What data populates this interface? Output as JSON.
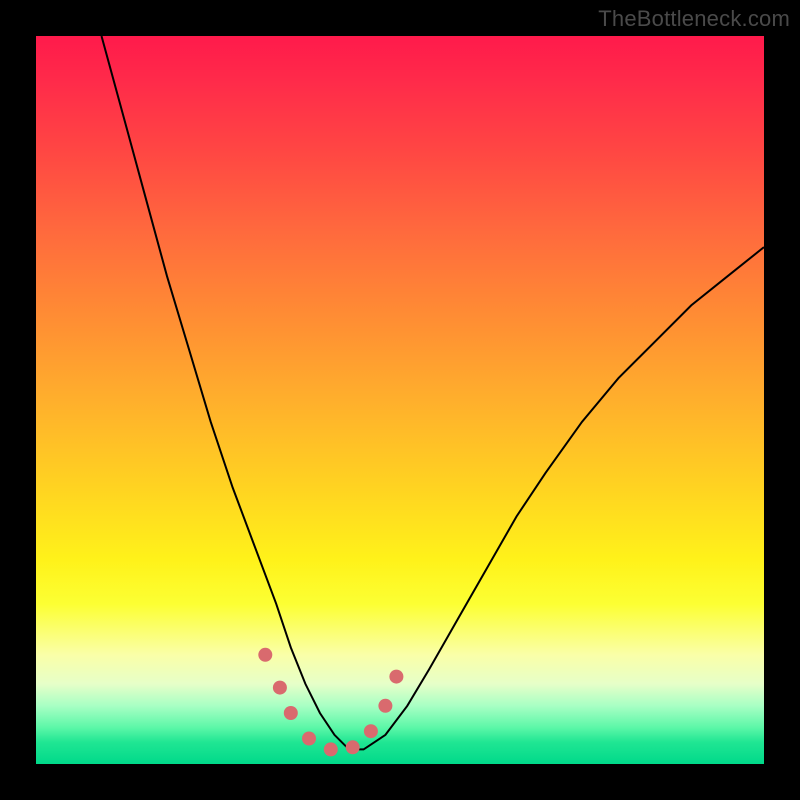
{
  "watermark": "TheBottleneck.com",
  "colors": {
    "frame": "#000000",
    "line": "#000000",
    "marker": "#d96a6e",
    "gradient_top": "#ff1a4b",
    "gradient_bottom": "#00d98a"
  },
  "chart_data": {
    "type": "line",
    "title": "",
    "xlabel": "",
    "ylabel": "",
    "xlim": [
      0,
      100
    ],
    "ylim": [
      0,
      100
    ],
    "note": "Axes are unlabeled in the source image; x/y values are normalized 0–100 estimates read from pixel positions. y represents height (0 = bottom green band, 100 = top red band).",
    "series": [
      {
        "name": "curve",
        "x": [
          9,
          12,
          15,
          18,
          21,
          24,
          27,
          30,
          33,
          35,
          37,
          39,
          41,
          43,
          45,
          48,
          51,
          54,
          58,
          62,
          66,
          70,
          75,
          80,
          85,
          90,
          95,
          100
        ],
        "y": [
          100,
          89,
          78,
          67,
          57,
          47,
          38,
          30,
          22,
          16,
          11,
          7,
          4,
          2,
          2,
          4,
          8,
          13,
          20,
          27,
          34,
          40,
          47,
          53,
          58,
          63,
          67,
          71
        ]
      }
    ],
    "markers": {
      "name": "highlighted-points",
      "x": [
        31.5,
        33.5,
        35.0,
        37.5,
        40.5,
        43.5,
        46.0,
        48.0,
        49.5
      ],
      "y": [
        15.0,
        10.5,
        7.0,
        3.5,
        2.0,
        2.3,
        4.5,
        8.0,
        12.0
      ],
      "r": [
        7,
        7,
        7,
        7,
        7,
        7,
        7,
        7,
        7
      ]
    }
  }
}
